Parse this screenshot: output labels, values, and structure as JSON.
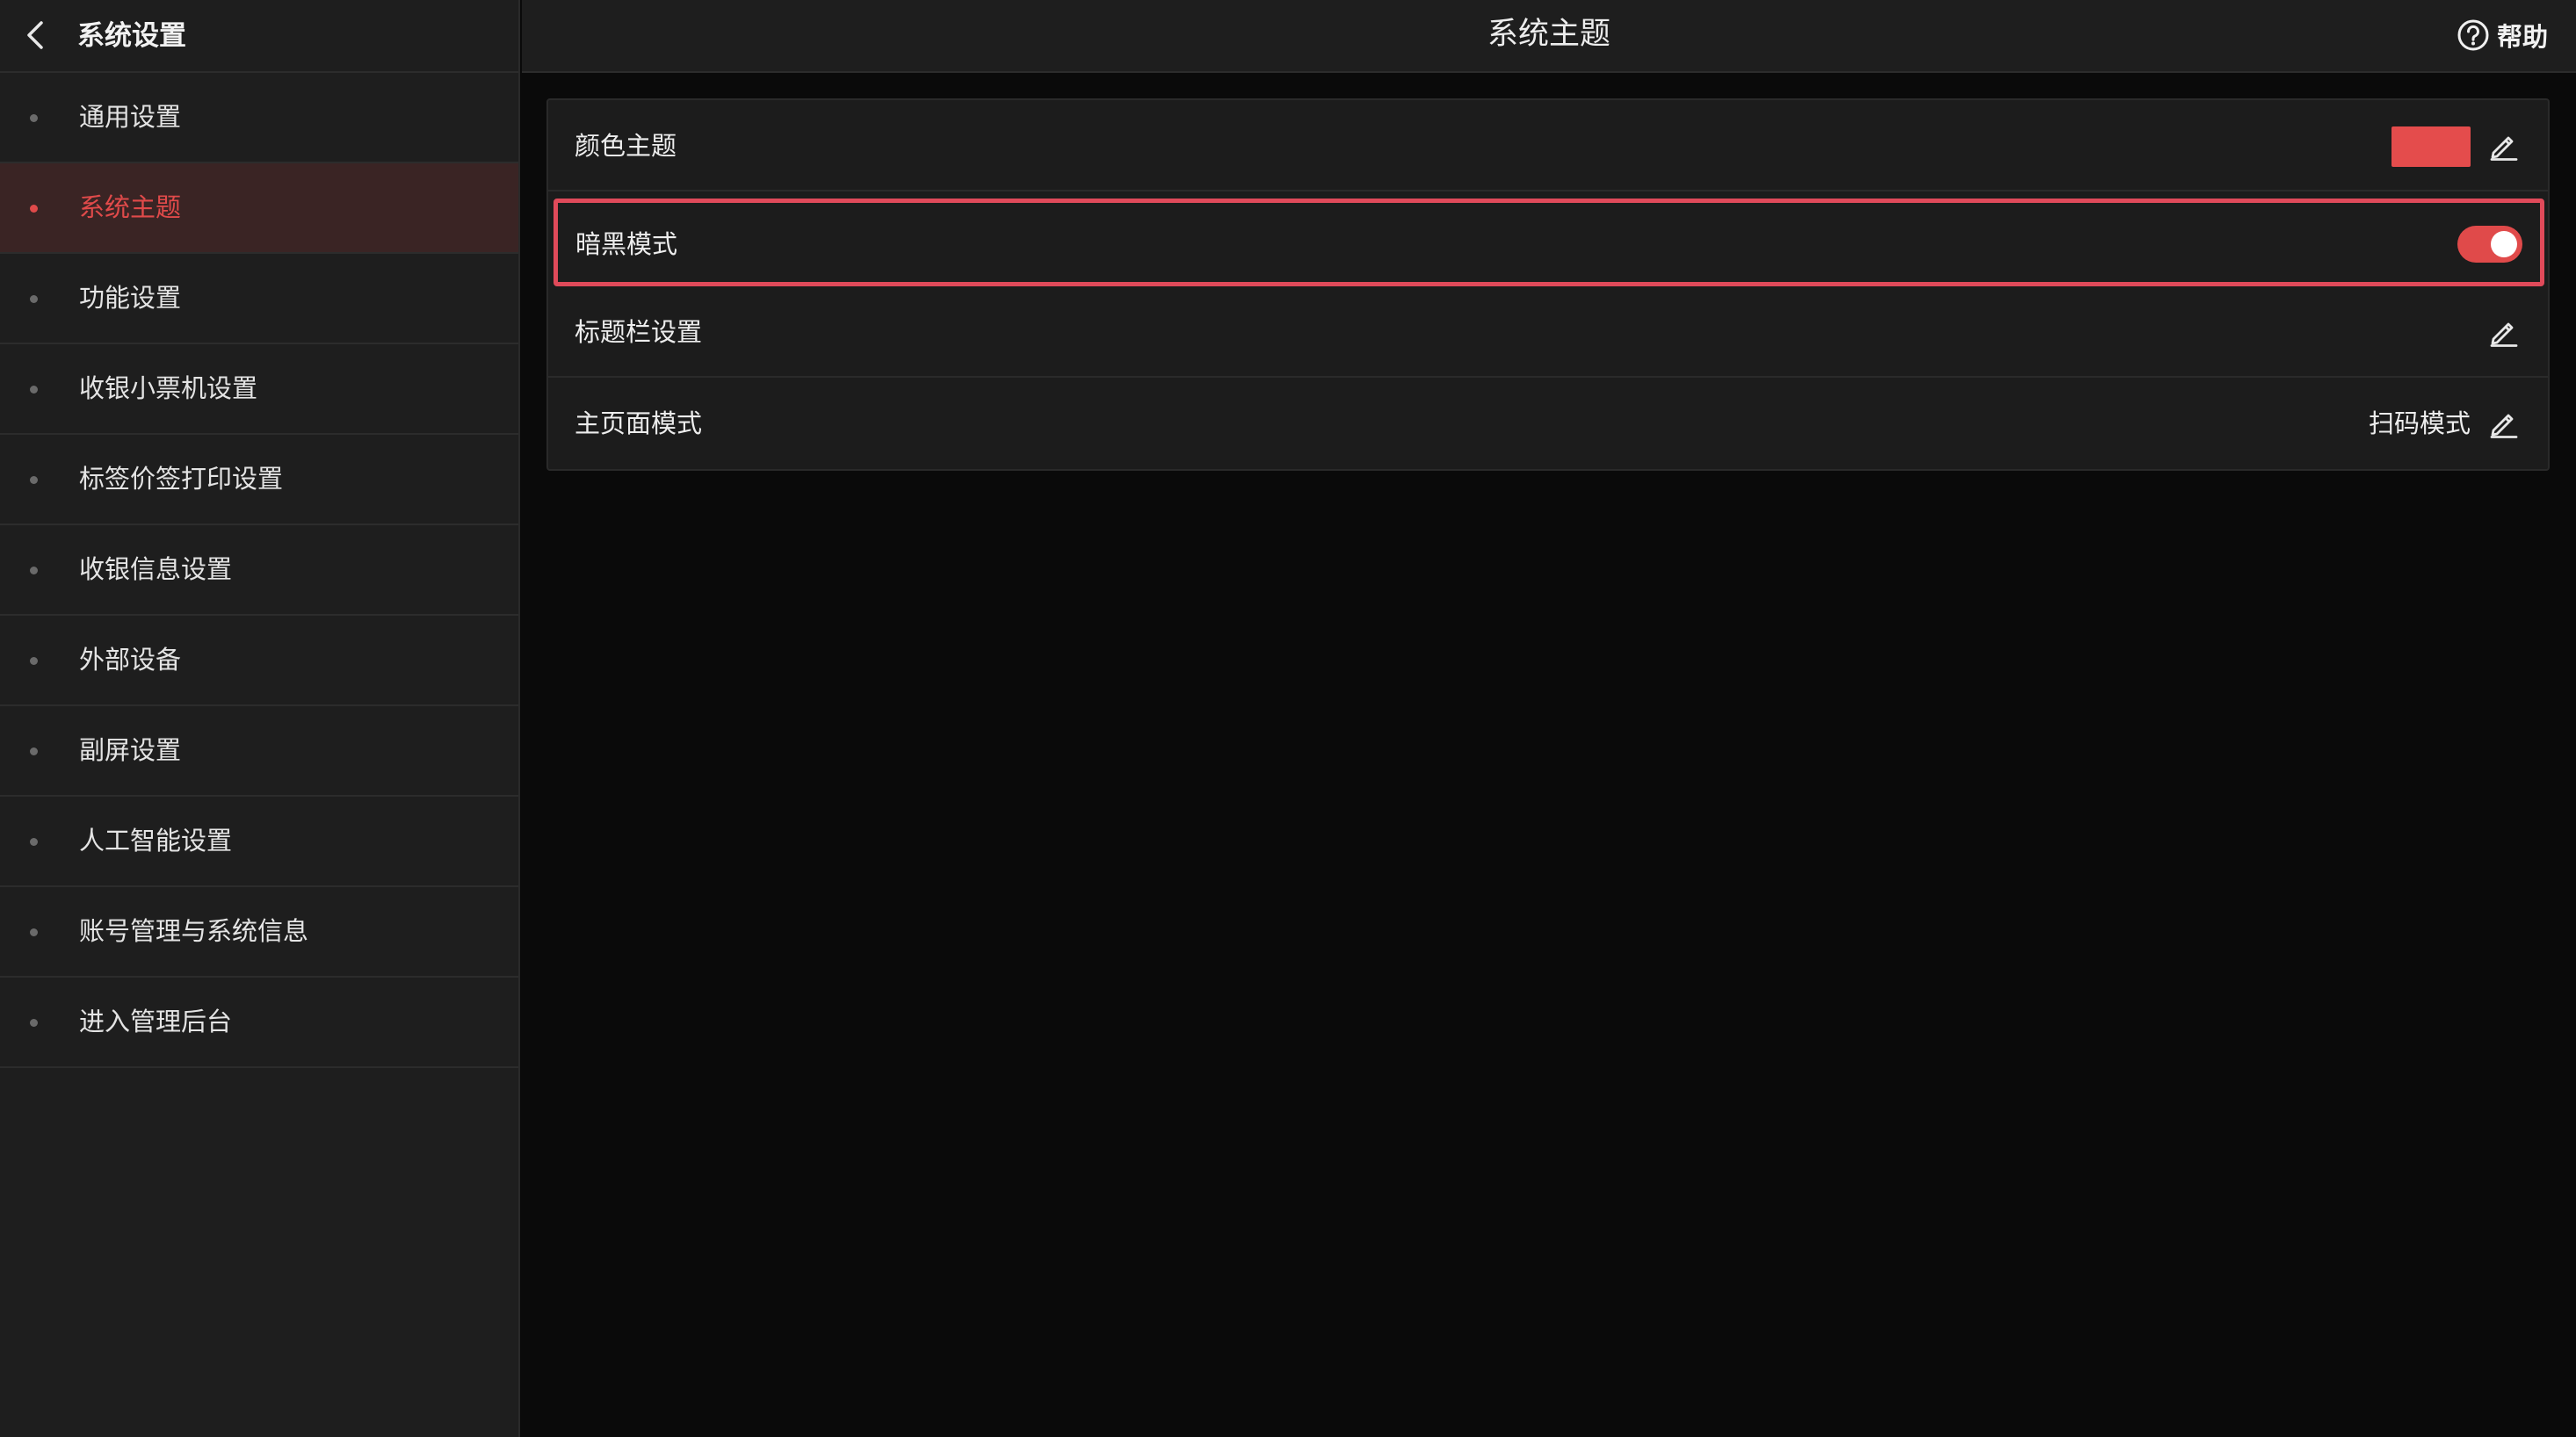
{
  "sidebar": {
    "title": "系统设置",
    "items": [
      {
        "label": "通用设置",
        "active": false
      },
      {
        "label": "系统主题",
        "active": true
      },
      {
        "label": "功能设置",
        "active": false
      },
      {
        "label": "收银小票机设置",
        "active": false
      },
      {
        "label": "标签价签打印设置",
        "active": false
      },
      {
        "label": "收银信息设置",
        "active": false
      },
      {
        "label": "外部设备",
        "active": false
      },
      {
        "label": "副屏设置",
        "active": false
      },
      {
        "label": "人工智能设置",
        "active": false
      },
      {
        "label": "账号管理与系统信息",
        "active": false
      },
      {
        "label": "进入管理后台",
        "active": false
      }
    ]
  },
  "header": {
    "title": "系统主题",
    "help_label": "帮助"
  },
  "settings": {
    "color_theme": {
      "label": "颜色主题",
      "color": "#e44c4c"
    },
    "dark_mode": {
      "label": "暗黑模式",
      "enabled": true
    },
    "titlebar": {
      "label": "标题栏设置"
    },
    "home_mode": {
      "label": "主页面模式",
      "value": "扫码模式"
    }
  },
  "colors": {
    "accent": "#e04a4a",
    "background": "#0a0a0a",
    "panel": "#1e1e1e",
    "highlight_border": "#e04a5a"
  },
  "icons": {
    "back": "chevron-left-icon",
    "help": "question-circle-icon",
    "edit": "pencil-icon"
  }
}
